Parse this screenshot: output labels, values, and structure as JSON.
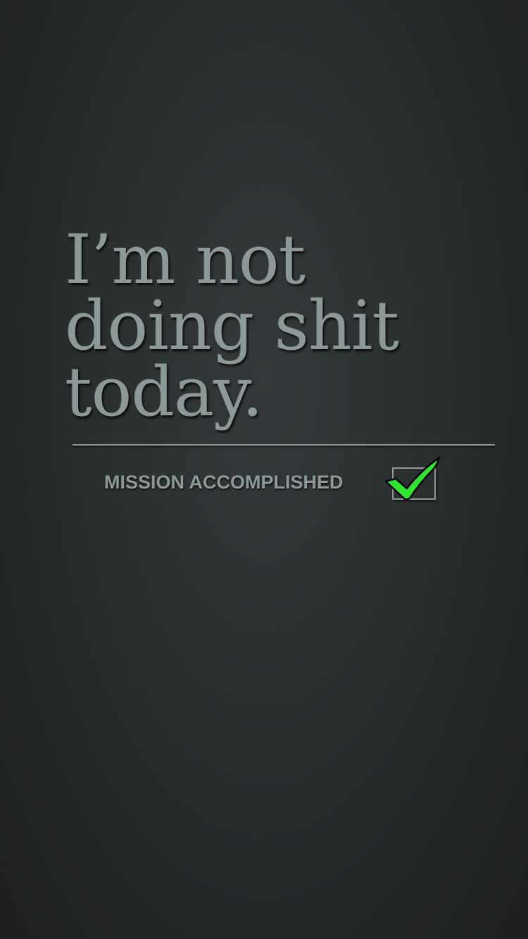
{
  "headline": {
    "line1": "I’m not",
    "line2": "doing shit",
    "line3": "today."
  },
  "mission": {
    "label": "MISSION ACCOMPLISHED",
    "checked": true,
    "check_color": "#2fe52f",
    "check_icon": "checkmark-icon"
  },
  "colors": {
    "text": "#8f9898",
    "background": "#2c3132"
  }
}
